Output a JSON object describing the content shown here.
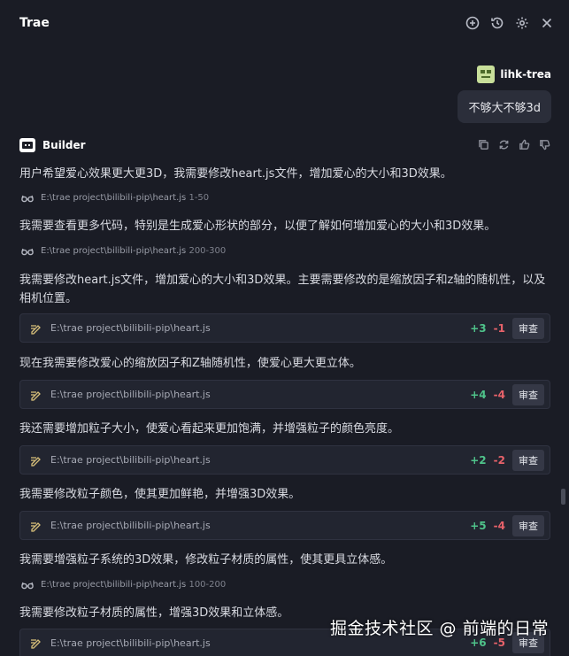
{
  "app": {
    "title": "Trae"
  },
  "header_icons": [
    "add-chat-icon",
    "history-icon",
    "gear-icon",
    "close-icon"
  ],
  "user": {
    "name": "lihk-trea",
    "message": "不够大不够3d"
  },
  "assistant": {
    "name": "Builder"
  },
  "messages": [
    "用户希望爱心效果更大更3D，我需要修改heart.js文件，增加爱心的大小和3D效果。",
    "我需要查看更多代码，特别是生成爱心形状的部分，以便了解如何增加爱心的大小和3D效果。",
    "我需要修改heart.js文件，增加爱心的大小和3D效果。主要需要修改的是缩放因子和z轴的随机性，以及相机位置。",
    "现在我需要修改爱心的缩放因子和Z轴随机性，使爱心更大更立体。",
    "我还需要增加粒子大小，使爱心看起来更加饱满，并增强粒子的颜色亮度。",
    "我需要修改粒子颜色，使其更加鲜艳，并增强3D效果。",
    "我需要增强粒子系统的3D效果，修改粒子材质的属性，使其更具立体感。",
    "我需要修改粒子材质的属性，增强3D效果和立体感。"
  ],
  "refs": [
    {
      "path": "E:\\trae project\\bilibili-pip\\heart.js",
      "range": "1-50"
    },
    {
      "path": "E:\\trae project\\bilibili-pip\\heart.js",
      "range": "200-300"
    },
    {
      "path": "E:\\trae project\\bilibili-pip\\heart.js",
      "range": "100-200"
    }
  ],
  "edits": [
    {
      "path": "E:\\trae project\\bilibili-pip\\heart.js",
      "added": "+3",
      "removed": "-1",
      "action": "审查"
    },
    {
      "path": "E:\\trae project\\bilibili-pip\\heart.js",
      "added": "+4",
      "removed": "-4",
      "action": "审查"
    },
    {
      "path": "E:\\trae project\\bilibili-pip\\heart.js",
      "added": "+2",
      "removed": "-2",
      "action": "审查"
    },
    {
      "path": "E:\\trae project\\bilibili-pip\\heart.js",
      "added": "+5",
      "removed": "-4",
      "action": "审查"
    },
    {
      "path": "E:\\trae project\\bilibili-pip\\heart.js",
      "added": "+6",
      "removed": "-5",
      "action": "审查"
    }
  ],
  "watermark": "掘金技术社区 @ 前端的日常",
  "colors": {
    "background": "#1a1c25",
    "added": "#4fc38a",
    "removed": "#e7626a"
  }
}
